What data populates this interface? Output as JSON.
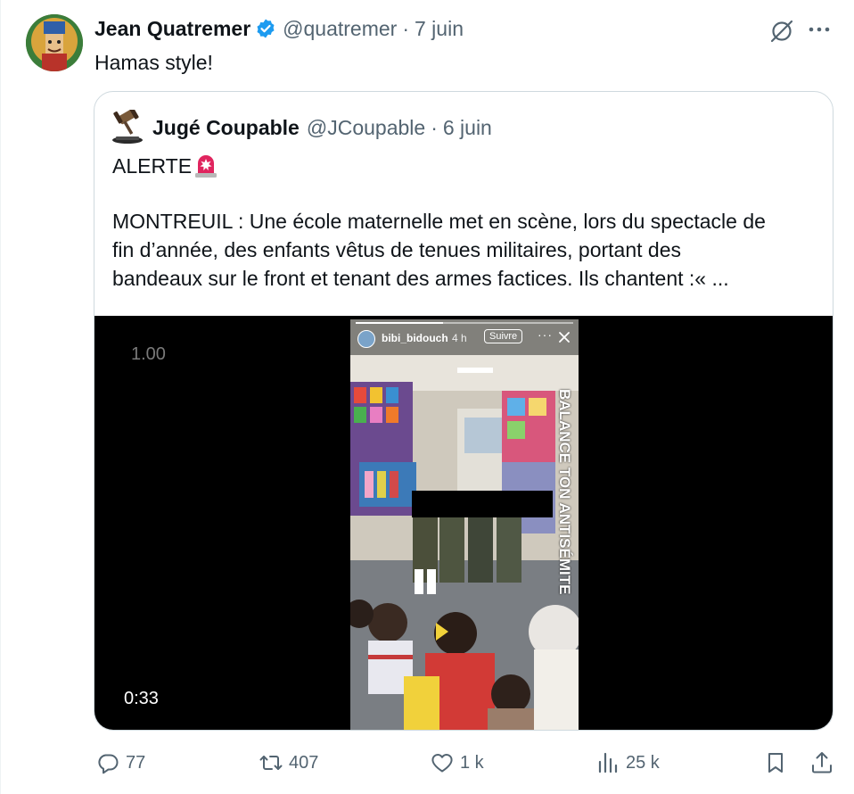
{
  "tweet": {
    "author_name": "Jean Quatremer",
    "handle": "@quatremer",
    "separator": "·",
    "date": "7 juin",
    "text": "Hamas style!"
  },
  "quote": {
    "author_name": "Jugé Coupable",
    "handle": "@JCoupable",
    "separator": "·",
    "date": "6 juin",
    "alert": "ALERTE",
    "body_lines": [
      "MONTREUIL : Une école maternelle met en scène, lors du spectacle de",
      "fin d’année, des enfants vêtus de tenues militaires, portant des",
      "bandeaux sur le front et tenant des armes factices. Ils chantent :« ..."
    ]
  },
  "media": {
    "speed": "1.00",
    "duration": "0:33",
    "story": {
      "username": "bibi_bidouch",
      "time": "4 h",
      "follow_label": "Suivre",
      "more": "···",
      "overlay_text": "BALANCE TON ANTISÉMITE"
    }
  },
  "actions": {
    "replies": "77",
    "retweets": "407",
    "likes": "1 k",
    "views": "25 k"
  },
  "colors": {
    "text": "#0f1419",
    "muted": "#536471",
    "verified": "#1d9bf0",
    "border": "#cfd9de",
    "media_bg": "#000000"
  },
  "icons": [
    "verified-badge-icon",
    "grok-icon",
    "more-icon",
    "gavel-icon",
    "siren-icon",
    "reply-icon",
    "retweet-icon",
    "like-icon",
    "views-icon",
    "bookmark-icon",
    "share-icon",
    "close-icon"
  ]
}
